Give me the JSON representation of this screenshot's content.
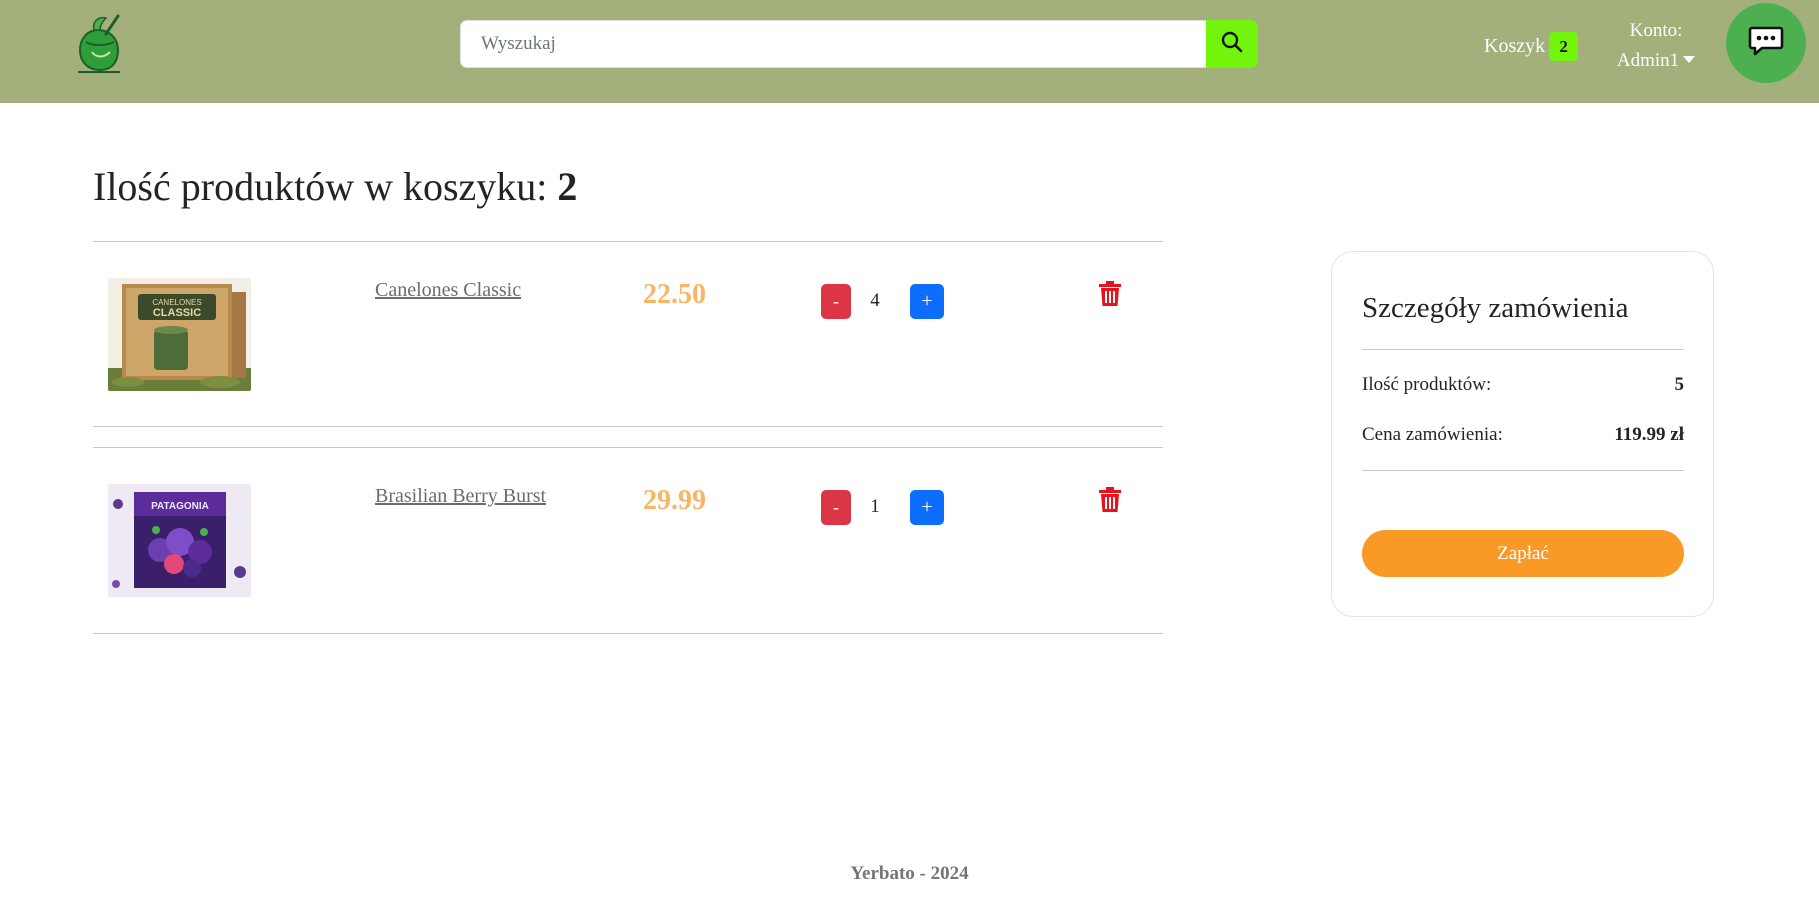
{
  "header": {
    "search_placeholder": "Wyszukaj",
    "cart_label": "Koszyk",
    "cart_count": "2",
    "account_label": "Konto:",
    "account_user": "Admin1"
  },
  "main": {
    "title_prefix": "Ilość produktów w koszyku:",
    "title_count": "2",
    "items": [
      {
        "name": "Canelones Classic",
        "price": "22.50",
        "quantity": "4",
        "minus_label": "-",
        "plus_label": "+",
        "image": "canelones-classic-box-image"
      },
      {
        "name": "Brasilian Berry Burst",
        "price": "29.99",
        "quantity": "1",
        "minus_label": "-",
        "plus_label": "+",
        "image": "berry-burst-box-image"
      }
    ]
  },
  "summary": {
    "title": "Szczegóły zamówienia",
    "products_label": "Ilość produktów:",
    "products_value": "5",
    "price_label": "Cena zamówienia:",
    "price_value": "119.99 zł",
    "pay_label": "Zapłać"
  },
  "footer": {
    "text": "Yerbato - 2024"
  },
  "colors": {
    "navbar": "#a3b07c",
    "accent_green": "#72f50b",
    "chat_green": "#4caf50",
    "price_orange": "#f9b565",
    "pay_orange": "#f99a26",
    "minus_red": "#dc3545",
    "plus_blue": "#0d6efd",
    "trash_red": "#e8121c"
  },
  "icons": {
    "logo": "yerba-mate-gourd-logo",
    "search": "search-icon",
    "chat": "chat-bubble-icon",
    "delete": "trash-icon"
  }
}
